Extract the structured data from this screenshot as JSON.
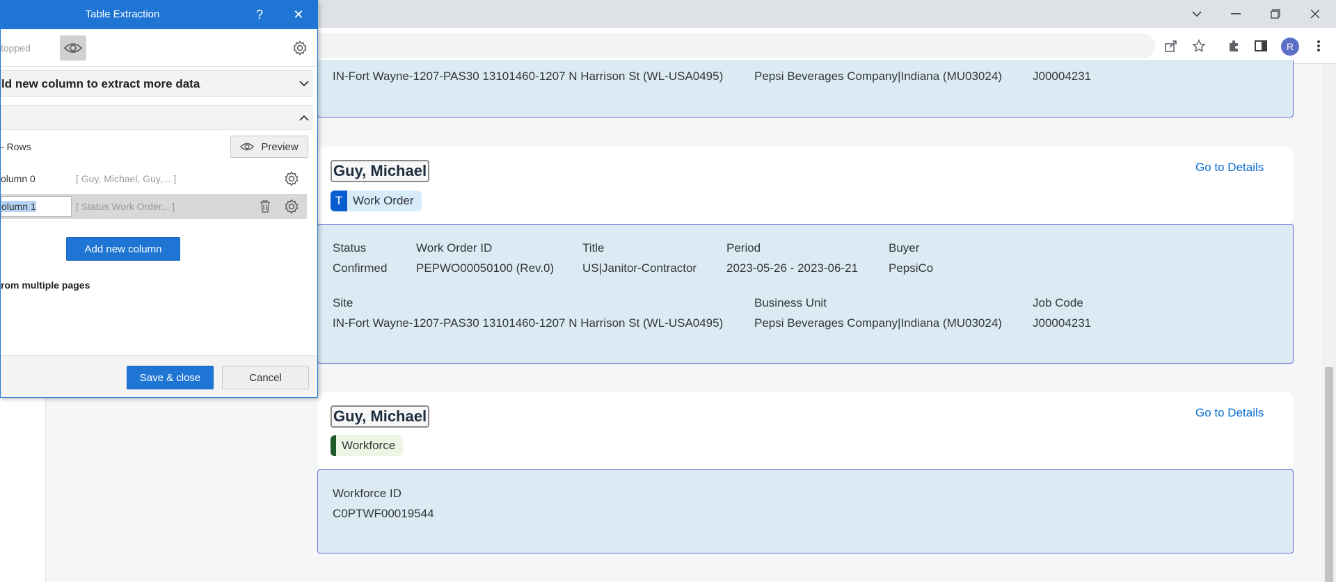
{
  "dialog": {
    "title": "Table Extraction",
    "help_icon": "?",
    "close_icon": "✕",
    "status_text": "topped",
    "add_column_section_label": "ld new column to extract more data",
    "rows_label": "Rows",
    "preview_label": "Preview",
    "columns": [
      {
        "name": "olumn 0",
        "preview": "[ Guy, Michael, Guy,...   ]"
      },
      {
        "name": "olumn 1",
        "preview": "[ Status Work Order...   ]"
      }
    ],
    "add_new_column_label": "Add new column",
    "multiple_pages_label": "rom multiple pages",
    "save_close_label": "Save & close",
    "cancel_label": "Cancel"
  },
  "browser": {
    "avatar_letter": "R"
  },
  "records": {
    "top_partial": {
      "site": "IN-Fort Wayne-1207-PAS30 13101460-1207 N Harrison St (WL-USA0495)",
      "business_unit": "Pepsi Beverages Company|Indiana (MU03024)",
      "job_code": "J00004231"
    },
    "work_order": {
      "name": "Guy, Michael",
      "go_to_details": "Go to Details",
      "tag_icon": "T",
      "tag_label": "Work Order",
      "headers": {
        "status": "Status",
        "work_order_id": "Work Order ID",
        "title": "Title",
        "period": "Period",
        "buyer": "Buyer",
        "site": "Site",
        "business_unit": "Business Unit",
        "job_code": "Job Code"
      },
      "values": {
        "status": "Confirmed",
        "work_order_id": "PEPWO00050100 (Rev.0)",
        "title": "US|Janitor-Contractor",
        "period": "2023-05-26 - 2023-06-21",
        "buyer": "PepsiCo",
        "site": "IN-Fort Wayne-1207-PAS30 13101460-1207 N Harrison St (WL-USA0495)",
        "business_unit": "Pepsi Beverages Company|Indiana (MU03024)",
        "job_code": "J00004231"
      }
    },
    "workforce": {
      "name": "Guy, Michael",
      "go_to_details": "Go to Details",
      "tag_label": "Workforce",
      "id_label": "Workforce ID",
      "id_value": "C0PTWF00019544"
    }
  }
}
